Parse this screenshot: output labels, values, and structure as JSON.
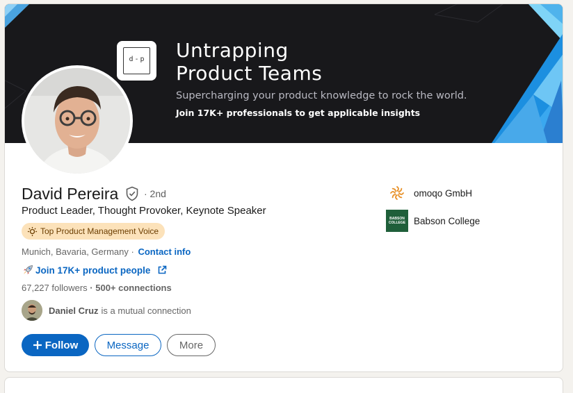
{
  "banner": {
    "logo_text": "d-p",
    "title": "Untrapping\nProduct Teams",
    "subtitle": "Supercharging your product knowledge to rock the world.",
    "cta": "Join 17K+ professionals to get applicable insights"
  },
  "profile": {
    "name": "David Pereira",
    "degree": "· 2nd",
    "headline": "Product Leader, Thought Provoker, Keynote Speaker",
    "badge": "Top Product Management Voice",
    "location": "Munich, Bavaria, Germany ·",
    "contact_label": "Contact info",
    "link_label": "Join 17K+ product people",
    "followers": "67,227 followers",
    "connections": "· 500+ connections",
    "mutual_name": "Daniel Cruz",
    "mutual_text": "is a mutual connection"
  },
  "actions": {
    "follow": "Follow",
    "message": "Message",
    "more": "More"
  },
  "organizations": [
    {
      "name": "omoqo GmbH"
    },
    {
      "name": "Babson College",
      "logo_text": "BABSON COLLEGE"
    }
  ],
  "colors": {
    "accent": "#0a66c2",
    "banner_bg": "#18181b",
    "badge_bg": "#fce2ba"
  }
}
